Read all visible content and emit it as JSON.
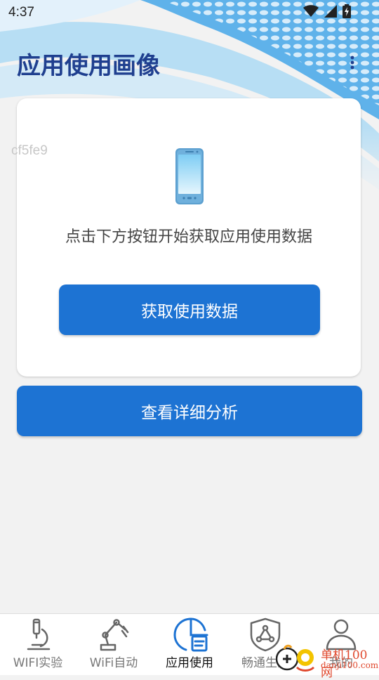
{
  "status_bar": {
    "time": "4:37",
    "icons": [
      "wifi-icon",
      "signal-icon",
      "battery-charging-icon"
    ]
  },
  "app_bar": {
    "title": "应用使用画像",
    "menu_icon": "more-vertical-icon"
  },
  "watermark": "cf5fe9",
  "card": {
    "icon": "smartphone-icon",
    "prompt": "点击下方按钮开始获取应用使用数据",
    "fetch_button": "获取使用数据"
  },
  "detail_button": "查看详细分析",
  "accent_color": "#1d73d3",
  "bottom_nav": {
    "items": [
      {
        "label": "WIFI实验",
        "icon": "microscope-icon",
        "active": false
      },
      {
        "label": "WiFi自动",
        "icon": "robot-arm-icon",
        "active": false
      },
      {
        "label": "应用使用",
        "icon": "app-usage-icon",
        "active": true
      },
      {
        "label": "畅通生活",
        "icon": "shield-network-icon",
        "active": false
      },
      {
        "label": "我的",
        "icon": "person-icon",
        "active": false
      }
    ]
  },
  "brand_overlay": {
    "cn": "单机100网",
    "en": "danji100.com",
    "icon": "danji-logo-icon"
  }
}
